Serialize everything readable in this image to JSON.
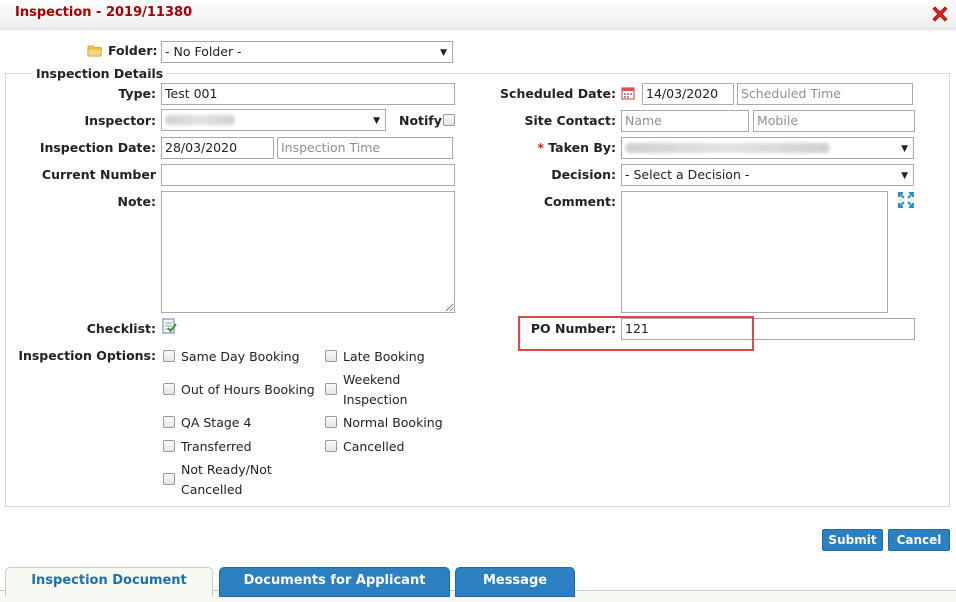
{
  "dialog": {
    "title": "Inspection - 2019/11380"
  },
  "folder": {
    "label": "Folder:",
    "value": "- No Folder -"
  },
  "details": {
    "legend": "Inspection Details",
    "type": {
      "label": "Type:",
      "value": "Test 001"
    },
    "inspector": {
      "label": "Inspector:",
      "notify_label": "Notify"
    },
    "inspection_date": {
      "label": "Inspection Date:",
      "value": "28/03/2020",
      "time_placeholder": "Inspection Time"
    },
    "current_number": {
      "label": "Current Number",
      "value": ""
    },
    "note": {
      "label": "Note:"
    },
    "checklist": {
      "label": "Checklist:"
    },
    "scheduled_date": {
      "label": "Scheduled Date:",
      "value": "14/03/2020",
      "time_placeholder": "Scheduled Time"
    },
    "site_contact": {
      "label": "Site Contact:",
      "name_placeholder": "Name",
      "mobile_placeholder": "Mobile"
    },
    "taken_by": {
      "label": "Taken By:",
      "required_mark": "*"
    },
    "decision": {
      "label": "Decision:",
      "value": "- Select a Decision -"
    },
    "comment": {
      "label": "Comment:"
    },
    "po_number": {
      "label": "PO Number:",
      "value": "121"
    },
    "options": {
      "label": "Inspection Options:",
      "left": [
        "Same Day Booking",
        "Out of Hours Booking",
        "QA Stage 4",
        "Transferred",
        "Not Ready/Not Cancelled"
      ],
      "right": [
        "Late Booking",
        "Weekend Inspection",
        "Normal Booking",
        "Cancelled"
      ],
      "left_wrapped_last": [
        "Not Ready/Not",
        "Cancelled"
      ],
      "right_wrapped_second": [
        "Weekend",
        "Inspection"
      ]
    }
  },
  "actions": {
    "submit": "Submit",
    "cancel": "Cancel"
  },
  "tabs": [
    "Inspection Document",
    "Documents for Applicant",
    "Message"
  ],
  "colors": {
    "title": "#a60000",
    "accent": "#2c7fc0",
    "highlight": "#e0474c"
  },
  "icons": [
    "folder-icon",
    "close-icon",
    "calendar-icon",
    "checklist-icon",
    "expand-icon"
  ]
}
